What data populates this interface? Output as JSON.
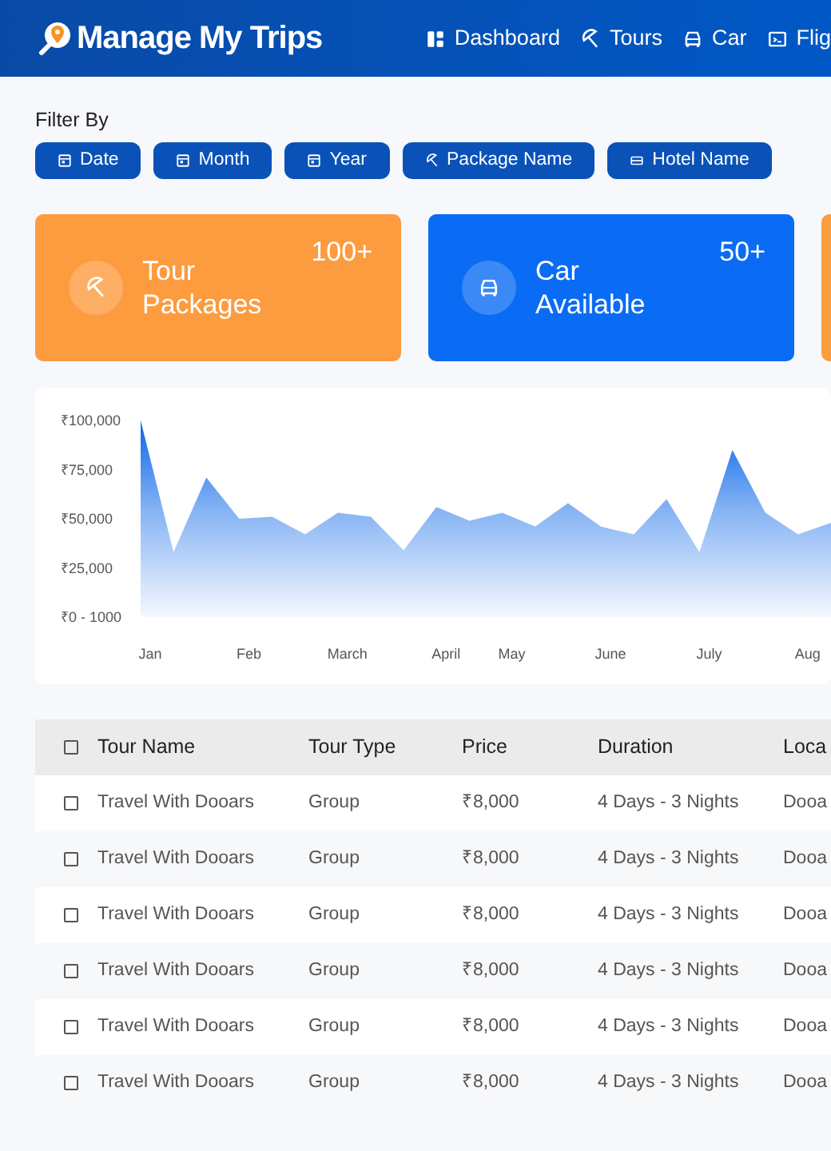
{
  "header": {
    "title": "Manage My Trips",
    "nav": [
      {
        "label": "Dashboard",
        "kind": "dashboard"
      },
      {
        "label": "Tours",
        "kind": "tours"
      },
      {
        "label": "Car",
        "kind": "car"
      },
      {
        "label": "Flig",
        "kind": "flight"
      }
    ]
  },
  "filters": {
    "label": "Filter By",
    "buttons": [
      {
        "label": "Date",
        "kind": "calendar"
      },
      {
        "label": "Month",
        "kind": "calendar"
      },
      {
        "label": "Year",
        "kind": "calendar"
      },
      {
        "label": "Package Name",
        "kind": "tours"
      },
      {
        "label": "Hotel Name",
        "kind": "hotel"
      }
    ]
  },
  "stats": [
    {
      "title": "Tour Packages",
      "count": "100+",
      "kind": "tours",
      "color": "#fd9b3f"
    },
    {
      "title": "Car Available",
      "count": "50+",
      "kind": "car",
      "color": "#0a6cf5"
    },
    {
      "color": "#fd9b3f"
    }
  ],
  "chart": {
    "chart_data": {
      "type": "area",
      "categories": [
        "Jan",
        null,
        null,
        "Feb",
        null,
        null,
        "March",
        null,
        null,
        "April",
        null,
        "May",
        null,
        null,
        "June",
        null,
        null,
        "July",
        null,
        null,
        "Aug",
        null
      ],
      "series": [
        {
          "color": "#0a66e8",
          "values": [
            100000,
            33000,
            71000,
            50000,
            51000,
            42000,
            53000,
            51000,
            34000,
            56000,
            49000,
            53000,
            46000,
            58000,
            46000,
            42000,
            60000,
            33000,
            85000,
            53000,
            42000,
            48000
          ]
        }
      ],
      "ylim": [
        0,
        100000
      ],
      "yticks": [
        {
          "value": 100000,
          "label": "₹100,000"
        },
        {
          "value": 75000,
          "label": "₹75,000"
        },
        {
          "value": 50000,
          "label": "₹50,000"
        },
        {
          "value": 25000,
          "label": "₹25,000"
        },
        {
          "value": 0,
          "label": "₹0 - 1000"
        }
      ]
    }
  },
  "table": {
    "header_checked": false,
    "columns": [
      "Tour Name",
      "Tour Type",
      "Price",
      "Duration",
      "Loca"
    ],
    "rows": [
      {
        "checked": false,
        "cells": [
          "Travel With Dooars",
          "Group",
          "₹8,000",
          "4 Days - 3 Nights",
          "Dooa"
        ]
      },
      {
        "checked": false,
        "cells": [
          "Travel With Dooars",
          "Group",
          "₹8,000",
          "4 Days - 3 Nights",
          "Dooa"
        ]
      },
      {
        "checked": false,
        "cells": [
          "Travel With Dooars",
          "Group",
          "₹8,000",
          "4 Days - 3 Nights",
          "Dooa"
        ]
      },
      {
        "checked": false,
        "cells": [
          "Travel With Dooars",
          "Group",
          "₹8,000",
          "4 Days - 3 Nights",
          "Dooa"
        ]
      },
      {
        "checked": false,
        "cells": [
          "Travel With Dooars",
          "Group",
          "₹8,000",
          "4 Days - 3 Nights",
          "Dooa"
        ]
      },
      {
        "checked": false,
        "cells": [
          "Travel With Dooars",
          "Group",
          "₹8,000",
          "4 Days - 3 Nights",
          "Dooa"
        ]
      }
    ]
  }
}
